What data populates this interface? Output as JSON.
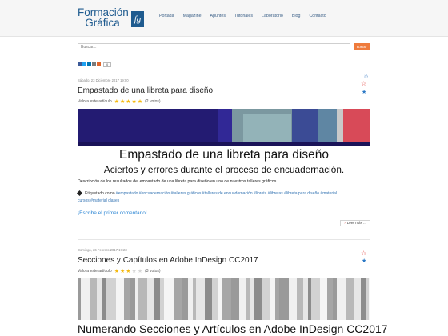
{
  "header": {
    "logo_line1": "Formación",
    "logo_line2": "Gráfica",
    "logo_mark": "fg",
    "nav": [
      "Portada",
      "Magazine",
      "Apuntes",
      "Tutoriales",
      "Laboratorio",
      "Blog",
      "Contacto"
    ]
  },
  "search": {
    "placeholder": "Buscar...",
    "button_label": "Buscar"
  },
  "share": {
    "count": "0",
    "icons": [
      "facebook-icon",
      "twitter-icon",
      "linkedin-icon",
      "email-icon",
      "more-icon"
    ]
  },
  "articles": [
    {
      "date": "Sábado, 23 Diciembre 2017 19:00",
      "title": "Empastado de una libreta para diseño",
      "rating_label": "Valora este artículo",
      "rating": 5,
      "votes": "(2 votos)",
      "heading": "Empastado de una libreta para diseño",
      "subheading": "Aciertos y errores durante el proceso de encuadernación.",
      "description": "Descripción de los resultados del empastado de una libreta para diseño en uno de nuestros talleres gráficos.",
      "tags_label": "Etiquetado como",
      "tags": [
        "#empastado",
        "#encuadernación",
        "#talleres gráficos",
        "#talleres de encuadernación",
        "#libreta",
        "#libretas",
        "#libreta para diseño",
        "#material",
        "cursos",
        "#material clases"
      ],
      "comment_link": "¡Escribe el primer comentario!",
      "read_more": "Leer más ..."
    },
    {
      "date": "Domingo, 26 Febrero 2017 17:23",
      "title": "Secciones y Capítulos en Adobe InDesign CC2017",
      "rating_label": "Valora este artículo",
      "rating": 3,
      "votes": "(3 votos)",
      "heading": "Numerando Secciones y Artículos en Adobe InDesign CC2017"
    }
  ],
  "colors": {
    "brand": "#1f5b8f",
    "link": "#3474b3",
    "accent": "#ef7b3c",
    "star": "#f5b90f"
  }
}
